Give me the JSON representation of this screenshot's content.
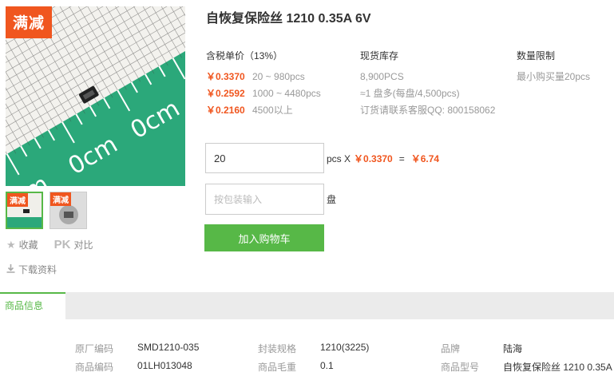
{
  "product": {
    "title": "自恢复保险丝 1210 0.35A 6V",
    "promo_tag": "满减",
    "thumb_tags": [
      "满减",
      "满减"
    ]
  },
  "actions": {
    "favorite": "收藏",
    "pk": "PK",
    "compare": "对比",
    "download": "下载资料"
  },
  "pricing": {
    "price_header": "含税单价（13%）",
    "stock_header": "现货库存",
    "limit_header": "数量限制",
    "tiers": [
      {
        "price": "￥0.3370",
        "range": "20 ~ 980pcs"
      },
      {
        "price": "￥0.2592",
        "range": "1000 ~ 4480pcs"
      },
      {
        "price": "￥0.2160",
        "range": "4500以上"
      }
    ],
    "stock_lines": [
      "8,900PCS",
      "≈1 盘多(每盘/4,500pcs)",
      "订货请联系客服QQ: 800158062"
    ],
    "limit_text": "最小购买量20pcs"
  },
  "order": {
    "qty_value": "20",
    "qty_unit": "pcs X",
    "unit_price": "￥0.3370",
    "equals": "=",
    "total": "￥6.74",
    "pkg_placeholder": "按包装输入",
    "pkg_unit": "盘",
    "add_to_cart": "加入购物车"
  },
  "tabs": {
    "active": "商品信息"
  },
  "specs": [
    {
      "k1": "原厂编码",
      "v1": "SMD1210-035",
      "k2": "封装规格",
      "v2": "1210(3225)",
      "k3": "品牌",
      "v3": "陆海"
    },
    {
      "k1": "商品编码",
      "v1": "01LH013048",
      "k2": "商品毛重",
      "v2": "0.1",
      "k3": "商品型号",
      "v3": "自恢复保险丝 1210 0.35A 6V"
    }
  ],
  "colors": {
    "accent_green": "#57b847",
    "price_orange": "#f0561f"
  }
}
